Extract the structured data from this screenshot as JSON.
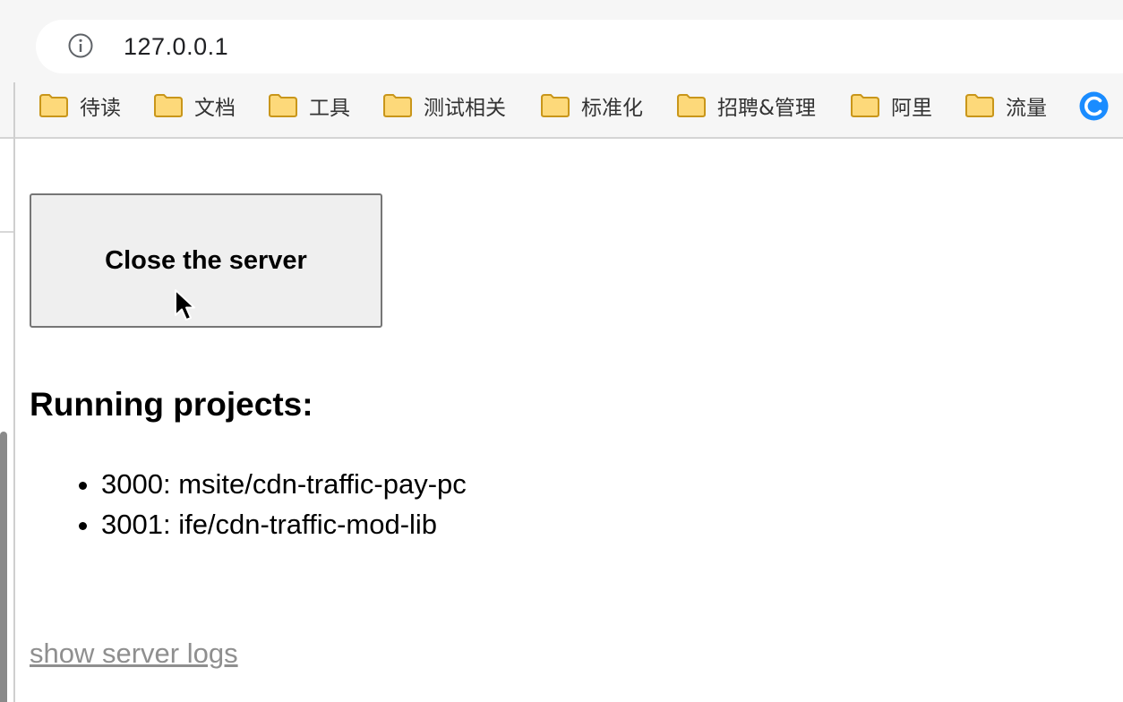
{
  "browser": {
    "url": "127.0.0.1",
    "bookmarks": [
      {
        "label": "待读",
        "icon": "folder-icon"
      },
      {
        "label": "文档",
        "icon": "folder-icon"
      },
      {
        "label": "工具",
        "icon": "folder-icon"
      },
      {
        "label": "测试相关",
        "icon": "folder-icon"
      },
      {
        "label": "标准化",
        "icon": "folder-icon"
      },
      {
        "label": "招聘&管理",
        "icon": "folder-icon"
      },
      {
        "label": "阿里",
        "icon": "folder-icon"
      },
      {
        "label": "流量",
        "icon": "folder-icon"
      }
    ],
    "extra_icon": "c-logo-icon"
  },
  "page": {
    "close_button_label": "Close the server",
    "heading": "Running projects:",
    "projects": [
      "3000: msite/cdn-traffic-pay-pc",
      "3001: ife/cdn-traffic-mod-lib"
    ],
    "logs_link": "show server logs"
  },
  "colors": {
    "folder_fill": "#fdd97a",
    "folder_stroke": "#c9961a",
    "c_logo": "#1a8cff",
    "link_gray": "#8f8f8f"
  }
}
